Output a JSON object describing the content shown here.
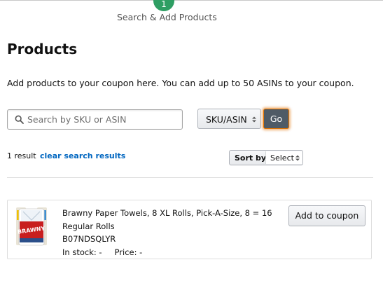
{
  "stepper": {
    "step_number": "1",
    "step_label": "Search & Add Products"
  },
  "page": {
    "title": "Products",
    "intro": "Add products to your coupon here. You can add up to 50 ASINs to your coupon."
  },
  "search": {
    "placeholder": "Search by SKU or ASIN",
    "value": "",
    "type_select": "SKU/ASIN",
    "go_label": "Go"
  },
  "results": {
    "count_text": "1 result",
    "clear_label": "clear search results",
    "sort_label": "Sort by:",
    "sort_value": "Select"
  },
  "products": [
    {
      "title": "Brawny Paper Towels, 8 XL Rolls, Pick-A-Size, 8 = 16 Regular Rolls",
      "asin": "B07NDSQLYR",
      "stock_text": "In stock: -",
      "price_text": "Price: -",
      "image_brand": "BRAWNY",
      "add_label": "Add to coupon"
    }
  ],
  "colors": {
    "step_green": "#2e9e63",
    "link_blue": "#0066c0",
    "go_button": "#4f5b66",
    "focus_orange": "#e77600"
  }
}
